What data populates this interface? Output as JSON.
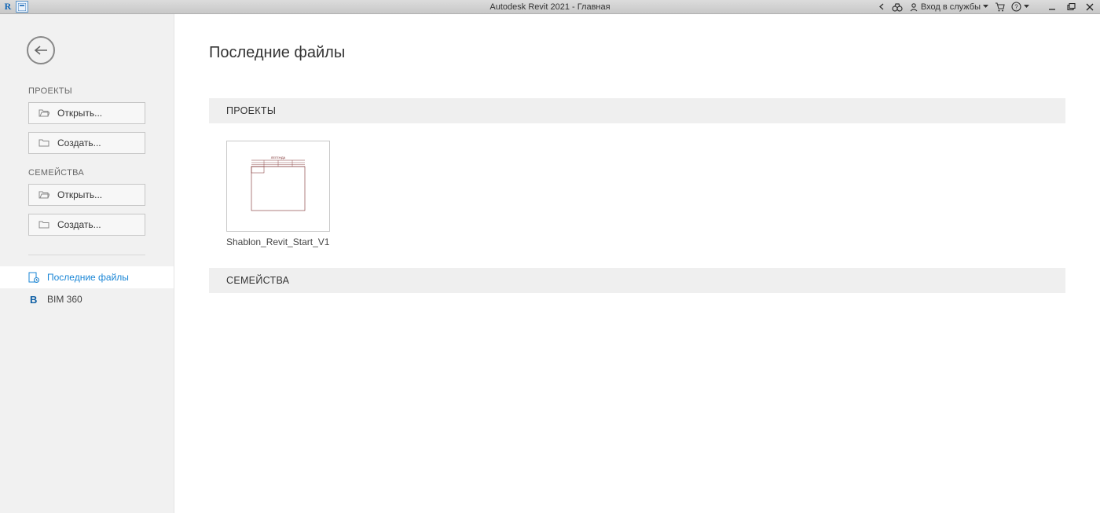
{
  "titlebar": {
    "title": "Autodesk Revit 2021 - Главная",
    "signin": "Вход в службы"
  },
  "sidebar": {
    "projects_label": "ПРОЕКТЫ",
    "families_label": "СЕМЕЙСТВА",
    "open_label": "Открыть...",
    "create_label": "Создать...",
    "nav_recent": "Последние файлы",
    "nav_bim360": "BIM 360"
  },
  "main": {
    "title": "Последние файлы",
    "projects_head": "ПРОЕКТЫ",
    "families_head": "СЕМЕЙСТВА",
    "recent_projects": [
      {
        "name": "Shablon_Revit_Start_V1"
      }
    ]
  }
}
